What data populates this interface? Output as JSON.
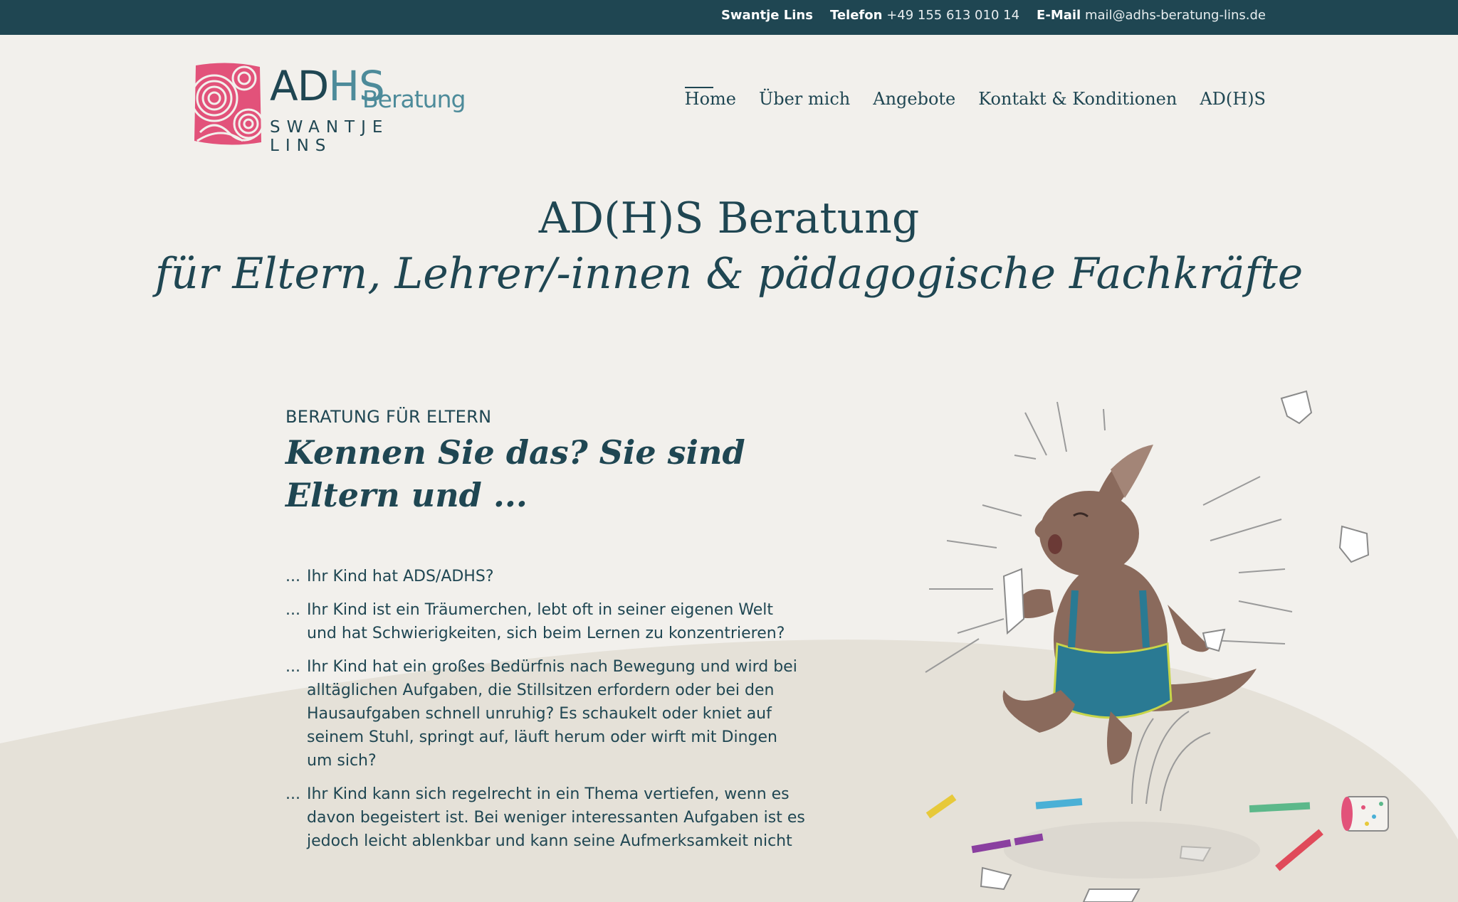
{
  "topbar": {
    "name": "Swantje Lins",
    "phone_label": "Telefon",
    "phone_value": "+49 155 613 010 14",
    "email_label": "E-Mail",
    "email_value": "mail@adhs-beratung-lins.de"
  },
  "logo": {
    "ad": "AD",
    "hs": "HS",
    "beratung": "Beratung",
    "name": "SWANTJE LINS"
  },
  "nav": {
    "items": [
      "Home",
      "Über mich",
      "Angebote",
      "Kontakt & Konditionen",
      "AD(H)S"
    ],
    "active": "Home"
  },
  "hero": {
    "line1": "AD(H)S Beratung",
    "line2": "für Eltern, Lehrer/-innen & pädagogische Fachkräfte"
  },
  "section": {
    "kicker": "BERATUNG FÜR ELTERN",
    "heading": "Kennen Sie das? Sie sind Eltern und ...",
    "bullet_marker": "...",
    "items": [
      "Ihr Kind hat ADS/ADHS?",
      "Ihr Kind ist ein Träumerchen, lebt oft in seiner eigenen Welt und hat Schwierigkeiten, sich beim Lernen zu konzentrieren?",
      "Ihr Kind hat ein großes Bedürfnis nach Bewegung und wird bei alltäglichen Aufgaben, die Stillsitzen erfordern oder bei den Hausaufgaben schnell unruhig? Es schaukelt oder kniet auf seinem Stuhl, springt auf, läuft herum oder wirft mit Dingen um sich?",
      "Ihr Kind kann sich regelrecht in ein Thema vertiefen, wenn es davon begeistert ist. Bei weniger interessanten Aufgaben ist es jedoch leicht ablenkbar und kann seine Aufmerksamkeit nicht"
    ]
  },
  "colors": {
    "primary": "#1f4652",
    "accent": "#4d8b9a",
    "logo_pink": "#e2527a",
    "background": "#f2f0ec",
    "hill": "#e5e1d8"
  },
  "icons": {
    "logo_mark": "fingerprint-circles-icon",
    "illustration": "kangaroo-tantrum-illustration"
  }
}
